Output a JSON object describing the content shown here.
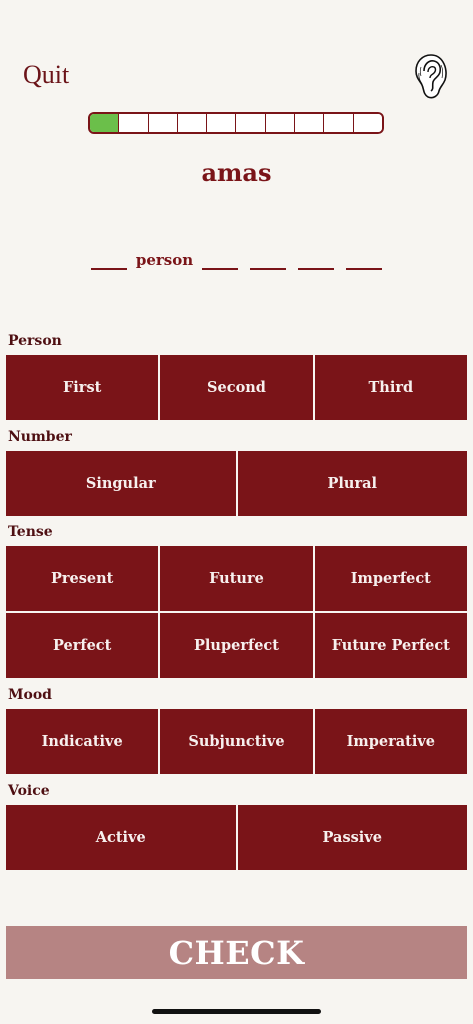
{
  "header": {
    "quit_label": "Quit",
    "ear_icon": "ear-icon"
  },
  "progress": {
    "total_segments": 10,
    "completed_segments": 1,
    "done_color": "#6bbf4a",
    "border_color": "#7a1418"
  },
  "word": "amas",
  "answer": {
    "person_label": "person"
  },
  "sections": {
    "person": {
      "label": "Person",
      "options": [
        "First",
        "Second",
        "Third"
      ]
    },
    "number": {
      "label": "Number",
      "options": [
        "Singular",
        "Plural"
      ]
    },
    "tense": {
      "label": "Tense",
      "options_row1": [
        "Present",
        "Future",
        "Imperfect"
      ],
      "options_row2": [
        "Perfect",
        "Pluperfect",
        "Future Perfect"
      ]
    },
    "mood": {
      "label": "Mood",
      "options": [
        "Indicative",
        "Subjunctive",
        "Imperative"
      ]
    },
    "voice": {
      "label": "Voice",
      "options": [
        "Active",
        "Passive"
      ]
    }
  },
  "check_label": "CHECK",
  "colors": {
    "background": "#f7f5f1",
    "accent": "#7a1418",
    "check_disabled": "#b68483"
  }
}
